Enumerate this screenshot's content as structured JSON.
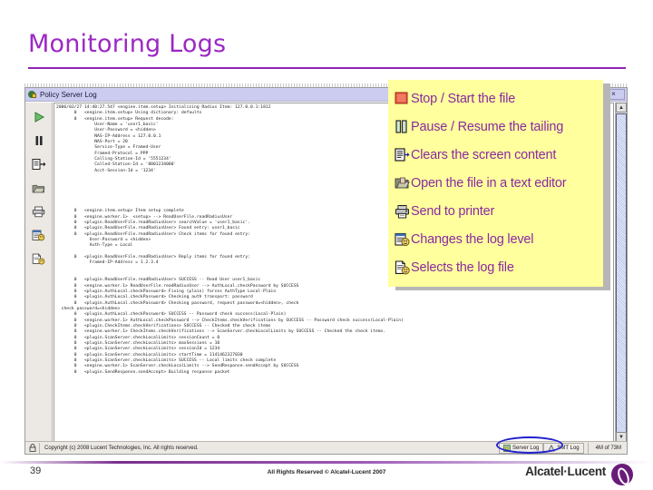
{
  "slide": {
    "title": "Monitoring Logs",
    "title_color": "#9C28C4",
    "page_number": "39",
    "footer_text": "All Rights Reserved © Alcatel-Lucent 2007",
    "brand": "Alcatel·Lucent"
  },
  "window": {
    "title": "Policy Server Log",
    "close_label": "×",
    "titlebar_color": "#ccccf0"
  },
  "toolbar": {
    "buttons": [
      {
        "name": "start-stop-button",
        "tooltip": "Stop / Start the file"
      },
      {
        "name": "pause-resume-button",
        "tooltip": "Pause / Resume the tailing"
      },
      {
        "name": "clear-screen-button",
        "tooltip": "Clears the screen content"
      },
      {
        "name": "open-in-editor-button",
        "tooltip": "Open the file in a text editor"
      },
      {
        "name": "print-button",
        "tooltip": "Send to printer"
      },
      {
        "name": "log-level-button",
        "tooltip": "Changes the log level"
      },
      {
        "name": "select-log-file-button",
        "tooltip": "Selects the log file"
      }
    ]
  },
  "callout": {
    "background": "#ffff9e",
    "text_color": "#8A2BA0",
    "items": [
      {
        "icon": "stop-start-icon",
        "label": "Stop / Start the file"
      },
      {
        "icon": "pause-resume-icon",
        "label": "Pause / Resume the tailing"
      },
      {
        "icon": "clear-screen-icon",
        "label": "Clears the screen content"
      },
      {
        "icon": "open-folder-icon",
        "label": "Open the file in a text editor"
      },
      {
        "icon": "printer-icon",
        "label": "Send to printer"
      },
      {
        "icon": "log-level-icon",
        "label": "Changes the log level"
      },
      {
        "icon": "select-log-file-icon",
        "label": "Selects the log file"
      }
    ]
  },
  "log": {
    "content": "2006/03/27 14:40:27.547 <engine.item.setup> Initializing Radius Item: 127.0.0.1:1812\n       0   <engine.item.setup> Using dictionary: defaults\n       0   <engine.item.setup> Request decode:\n               User-Name = 'user1_basic'\n               User-Password = <hidden>\n               NAS-IP-Address = 127.0.0.1\n               NAS-Port = 20\n               Service-Type = Framed-User\n               Framed-Protocol = PPP\n               Calling-Station-Id = '5551234'\n               Called-Station-Id = '8001234000'\n               Acct-Session-Id = '1234'\n\n\n\n\n\n\n       0   <engine.item.setup> Item setup complete\n       0   <engine.worker.1>  <setup> --> ReadUserFile.readRadiusUser\n       0   <plugin.ReadUserFile.readRadiusUser> searchValue = 'user1_basic'.\n       0   <plugin.ReadUserFile.readRadiusUser> Found entry: user1_basic\n       0   <plugin.ReadUserFile.readRadiusUser> Check items for found entry:\n             User-Password = <hidden>\n             Auth-Type = Local\n\n       0   <plugin.ReadUserFile.readRadiusUser> Reply items for found entry:\n             Framed-IP-Address = 1.2.3.4\n\n\n       0   <plugin.ReadUserFile.readRadiusUser> SUCCESS -- Read User user1_basic\n       0   <engine.worker.1> ReadUserFile.readRadiusUser --> AuthLocal.checkPassword by SUCCESS\n       0   <plugin.AuthLocal.checkPassword> Fixing (plain) forces AuthType Local-Plain\n       0   <plugin.AuthLocal.checkPassword> Checking auth transport: password\n       0   <plugin.AuthLocal.checkPassword> Checking password, request password=<hidden>, check\n  check password=<hidden>\n       0   <plugin.AuthLocal.checkPassword> SUCCESS -- Password check success(Local-Plain)\n       0   <engine.worker.1> AuthLocal.checkPassword --> CheckItems.checkVerifications by SUCCESS -- Password check success(Local-Plain)\n       0   <plugin.CheckItems.checkVerifications> SUCCESS -- Checked the check items\n       0   <engine.worker.1> CheckItems.checkVerifications --> ScanServer.checkLocalLimits by SUCCESS -- Checked the check items.\n       0   <plugin.ScanServer.checkLocalLimits> sessionCount = 0\n       0   <plugin.ScanServer.checkLocalLimits> maxSessions = 10\n       0   <plugin.ScanServer.checkLocalLimits> sessionId = 1234\n       0   <plugin.ScanServer.checkLocalLimits> startTime = 1141462327030\n       0   <plugin.ScanServer.checkLocalLimits> SUCCESS -- Local limits check complete\n       0   <engine.worker.1> ScanServer.checkLocalLimits --> SendResponse.sendAccept by SUCCESS\n       0   <plugin.SendResponse.sendAccept> Building response packet\n"
  },
  "statusbar": {
    "copyright": "Copyright (c) 2008 Lucent Technologies, Inc. All rights reserved.",
    "tabs": [
      {
        "name": "server-log",
        "label": "Server Log",
        "selected": true
      },
      {
        "name": "smt-log",
        "label": "SMT Log",
        "selected": false
      }
    ],
    "memory": "4M of 73M"
  }
}
